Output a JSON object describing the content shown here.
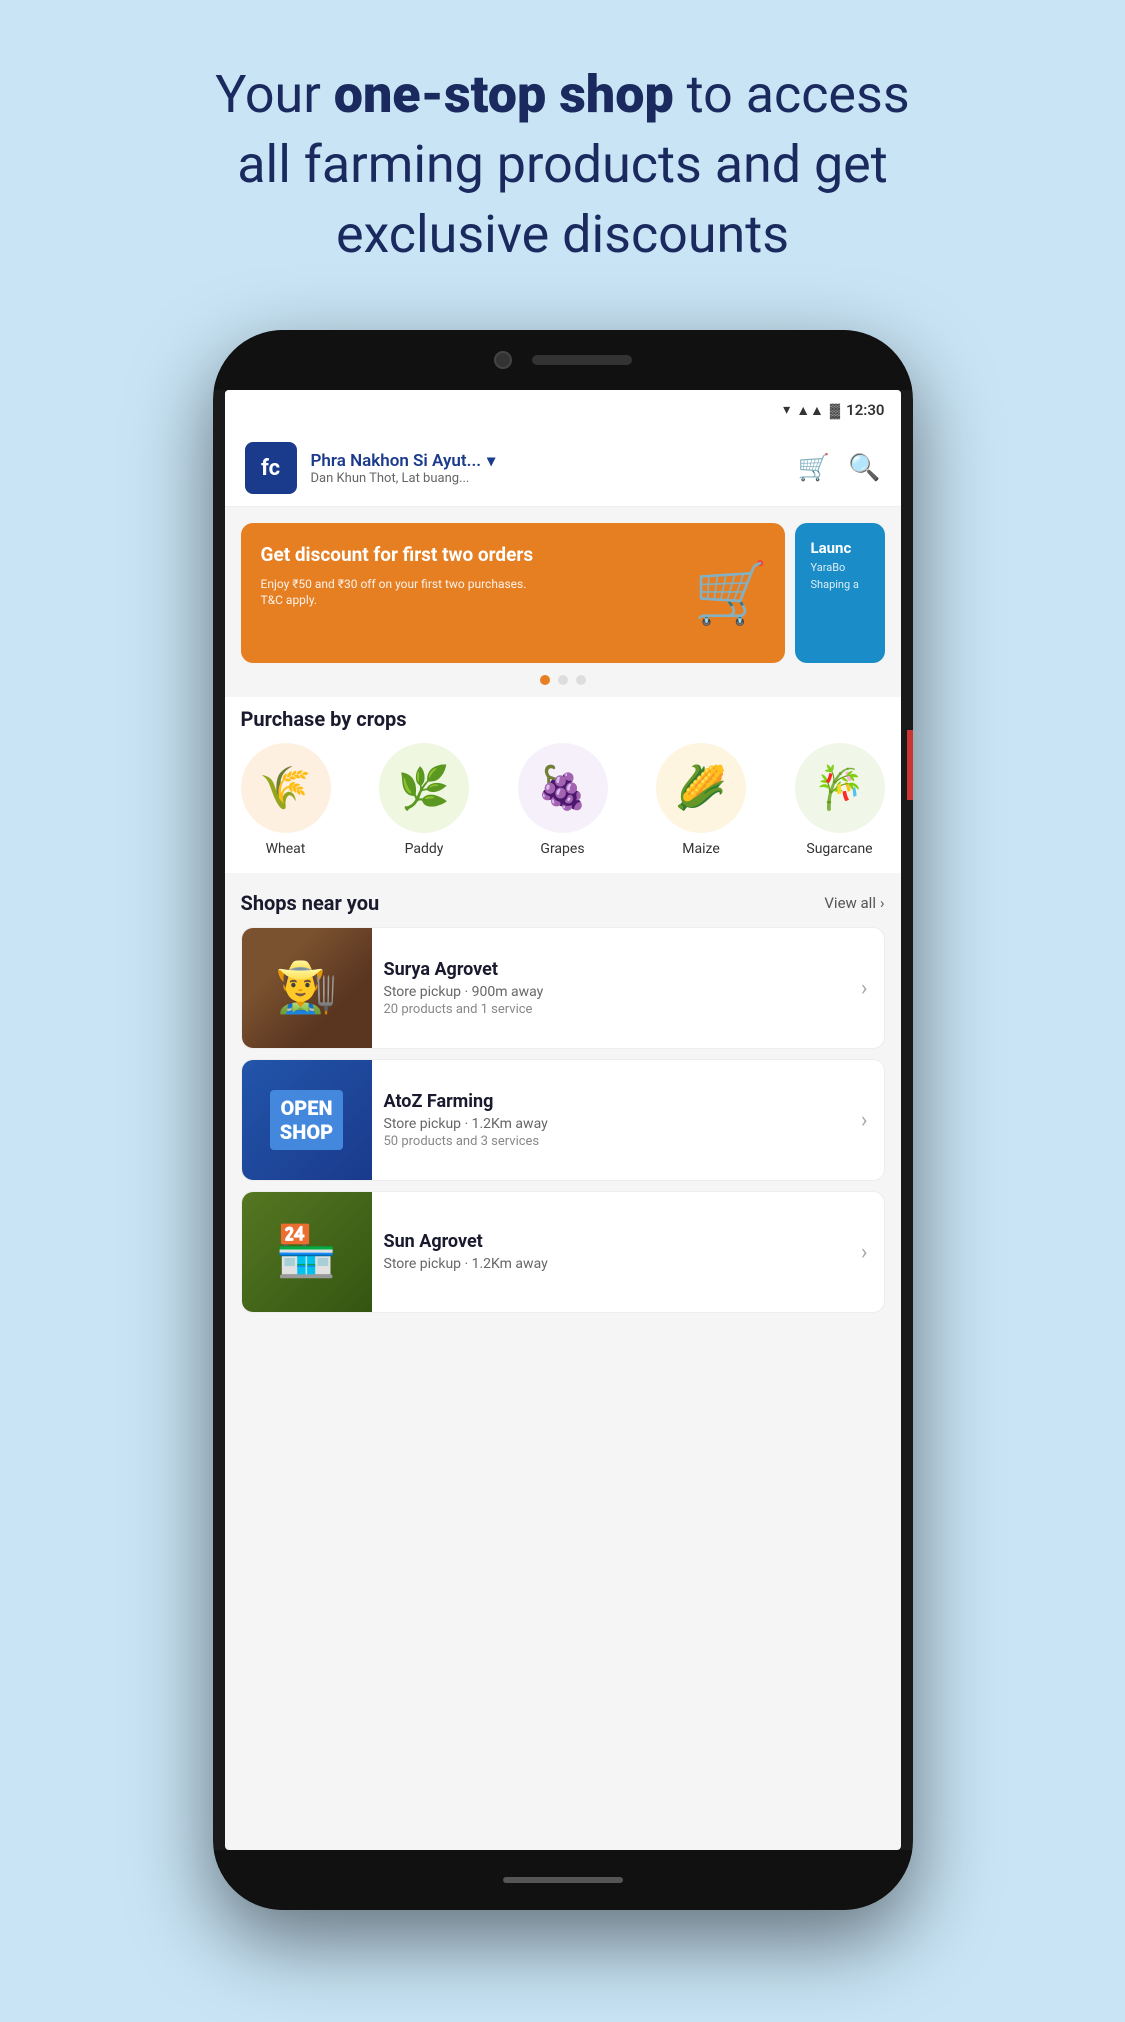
{
  "page": {
    "background_color": "#c8e4f5"
  },
  "tagline": {
    "line1": "Your ",
    "bold": "one-stop shop",
    "line2": " to access",
    "line3": "all farming products and get",
    "line4": "exclusive discounts"
  },
  "status_bar": {
    "time": "12:30",
    "wifi_icon": "▼",
    "signal_icon": "▲",
    "battery_icon": "🔋"
  },
  "header": {
    "logo_text": "fc",
    "location_name": "Phra Nakhon Si Ayut...",
    "location_sub": "Dan Khun Thot, Lat buang...",
    "cart_icon": "cart",
    "search_icon": "search"
  },
  "banner": {
    "main": {
      "title": "Get discount for first two orders",
      "subtitle": "Enjoy ₹50 and ₹30 off on your first two purchases. T&C apply.",
      "bg_color": "#e67e22"
    },
    "secondary": {
      "title": "Launc",
      "subtitle": "YaraBo",
      "sub2": "Shaping a",
      "bg_color": "#1a8cc8"
    },
    "dots": [
      "active",
      "inactive",
      "inactive"
    ]
  },
  "purchase_crops": {
    "section_title": "Purchase by crops",
    "crops": [
      {
        "name": "Wheat",
        "emoji": "🌾",
        "color": "#fdf0e0"
      },
      {
        "name": "Paddy",
        "emoji": "🌿",
        "color": "#f0f7e0"
      },
      {
        "name": "Grapes",
        "emoji": "🍇",
        "color": "#f5f0fa"
      },
      {
        "name": "Maize",
        "emoji": "🌽",
        "color": "#fdf5e0"
      },
      {
        "name": "Sugarcane",
        "emoji": "🎋",
        "color": "#f0f7e8"
      }
    ]
  },
  "shops": {
    "section_title": "Shops near you",
    "view_all_label": "View all",
    "items": [
      {
        "name": "Surya Agrovet",
        "pickup": "Store pickup · 900m away",
        "products": "20 products and 1 service",
        "image_type": "store_man"
      },
      {
        "name": "AtoZ Farming",
        "pickup": "Store pickup · 1.2Km away",
        "products": "50 products and 3 services",
        "image_type": "open_sign"
      },
      {
        "name": "Sun Agrovet",
        "pickup": "Store pickup · 1.2Km away",
        "products": "",
        "image_type": "store_generic"
      }
    ]
  }
}
